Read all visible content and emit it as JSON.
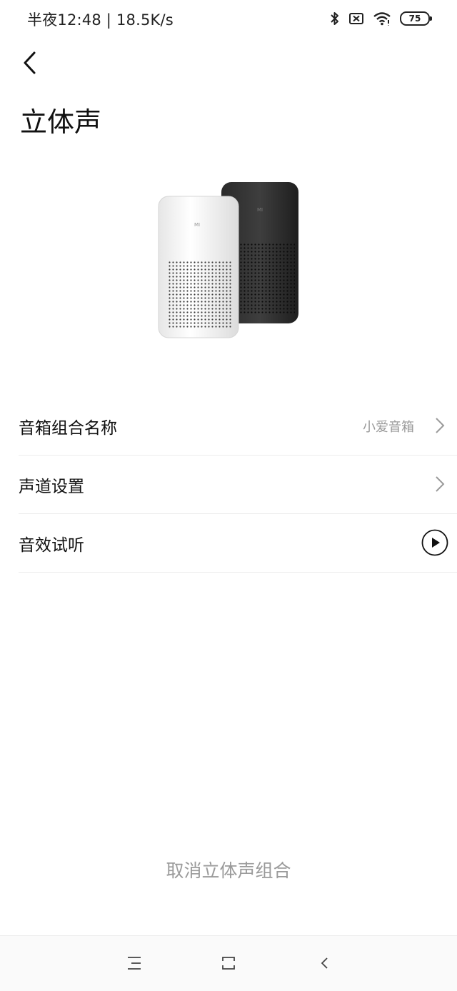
{
  "status_bar": {
    "time_speed": "半夜12:48 | 18.5K/s",
    "icons": [
      "bluetooth-icon",
      "no-sim-icon",
      "wifi-icon",
      "battery-icon"
    ],
    "battery": "75"
  },
  "header": {
    "back_icon": "back-arrow-icon",
    "title": "立体声"
  },
  "hero": {
    "image": "two-smart-speakers-white-and-black",
    "brand_mark": "MI"
  },
  "settings": {
    "items": [
      {
        "label": "音箱组合名称",
        "value": "小爱音箱",
        "trailing": "chevron-right-icon"
      },
      {
        "label": "声道设置",
        "value": "",
        "trailing": "chevron-right-icon"
      },
      {
        "label": "音效试听",
        "value": "",
        "trailing": "play-icon"
      }
    ]
  },
  "footer": {
    "cancel_label": "取消立体声组合"
  },
  "nav_bar": {
    "icons": [
      "menu-icon",
      "home-icon",
      "back-icon"
    ]
  },
  "colors": {
    "text_primary": "#111111",
    "text_secondary": "#9a9a9a",
    "divider": "#ececec",
    "background": "#ffffff"
  }
}
